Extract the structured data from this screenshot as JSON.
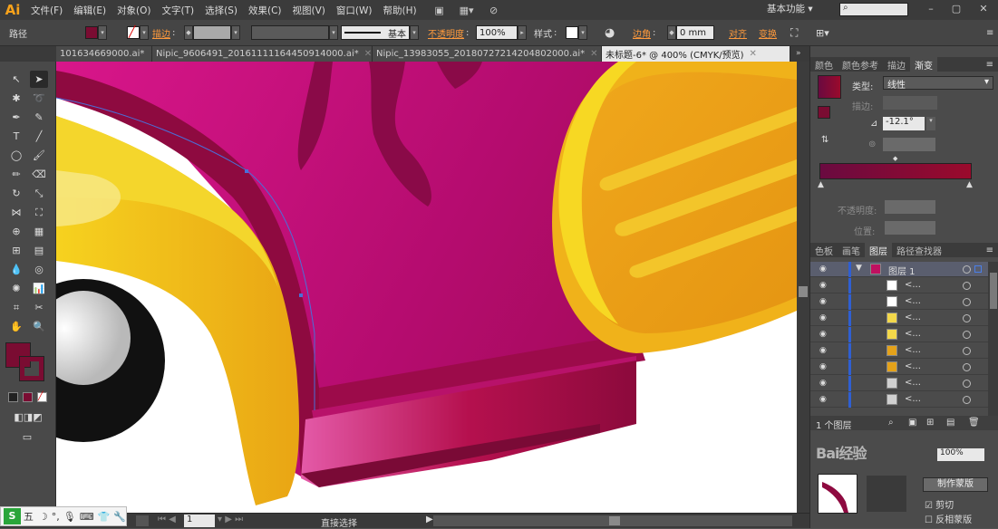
{
  "app": {
    "logo": "Ai"
  },
  "menu": [
    "文件(F)",
    "编辑(E)",
    "对象(O)",
    "文字(T)",
    "选择(S)",
    "效果(C)",
    "视图(V)",
    "窗口(W)",
    "帮助(H)"
  ],
  "workspace": "基本功能",
  "search": {
    "placeholder": ""
  },
  "control": {
    "selection": "路径",
    "stroke_label": "描边",
    "brush_label": "基本",
    "opacity_label": "不透明度",
    "opacity_value": "100%",
    "style_label": "样式",
    "corner_label": "边角",
    "corner_value": "0 mm",
    "align_label": "对齐",
    "transform_label": "变换",
    "fill_color": "#7a0c32"
  },
  "tabs": [
    {
      "label": "101634669000.ai*",
      "active": false
    },
    {
      "label": "Nipic_9606491_20161111164450914000.ai*",
      "active": false
    },
    {
      "label": "Nipic_13983055_20180727214204802000.ai*",
      "active": false
    },
    {
      "label": "未标题-6* @ 400% (CMYK/预览)",
      "active": true
    }
  ],
  "tools": {
    "fill_color": "#7a0c32",
    "stroke_color": "#7a0c32"
  },
  "status": {
    "zoom": "400%",
    "page": "1",
    "tool_name": "直接选择"
  },
  "gradient_panel": {
    "tabs": [
      "颜色",
      "颜色参考",
      "描边",
      "渐变"
    ],
    "type_label": "类型",
    "type_value": "线性",
    "stroke_label": "描边",
    "angle_value": "-12.1°",
    "opacity_label": "不透明度",
    "location_label": "位置",
    "stop_left": "#6a0a40",
    "stop_right": "#9a0a2c"
  },
  "layers_panel": {
    "tabs": [
      "色板",
      "画笔",
      "图层",
      "路径查找器"
    ],
    "layer_name": "图层 1",
    "rows": [
      "<...",
      "<...",
      "<...",
      "<...",
      "<...",
      "<...",
      "<...",
      "<..."
    ],
    "footer": "1 个图层"
  },
  "bottom_panel": {
    "opacity_value": "100%",
    "make_mask": "制作蒙版",
    "clip": "剪切",
    "invert_mask": "反相蒙版"
  },
  "ime": {
    "label": "五"
  }
}
